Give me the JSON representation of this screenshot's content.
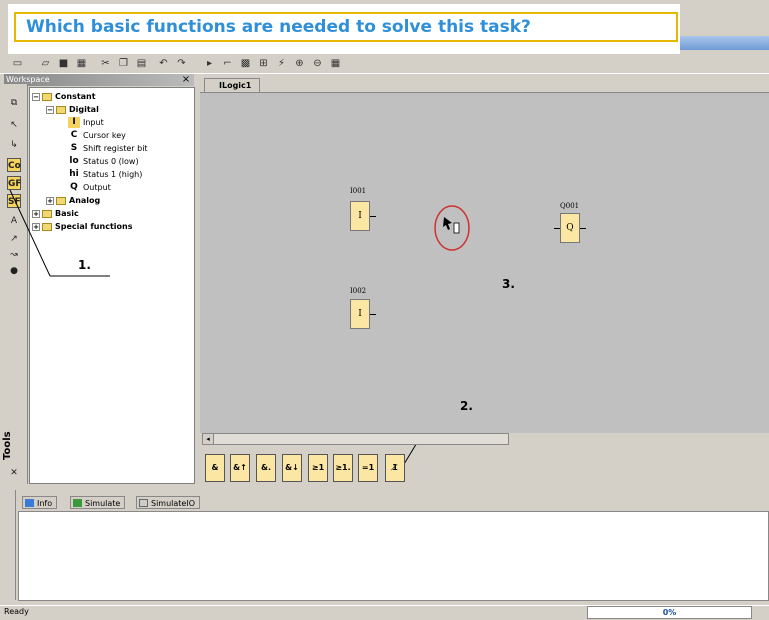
{
  "question": "Which basic functions are needed to solve this task?",
  "workspace": {
    "title": "Workspace",
    "close": "×",
    "tools_label": "Tools"
  },
  "tree": {
    "constant": "Constant",
    "digital": "Digital",
    "items": [
      {
        "icon": "I",
        "label": "Input"
      },
      {
        "icon": "C",
        "label": "Cursor key"
      },
      {
        "icon": "S",
        "label": "Shift register bit"
      },
      {
        "icon": "lo",
        "label": "Status 0 (low)"
      },
      {
        "icon": "hi",
        "label": "Status 1 (high)"
      },
      {
        "icon": "Q",
        "label": "Output"
      }
    ],
    "analog": "Analog",
    "basic": "Basic",
    "special": "Special functions"
  },
  "document_tab": "ILogic1",
  "blocks": {
    "i001_label": "I001",
    "i001_text": "I",
    "i002_label": "I002",
    "i002_text": "I",
    "q001_label": "Q001",
    "q001_text": "Q"
  },
  "annotations": {
    "one": "1.",
    "two": "2.",
    "three": "3."
  },
  "function_buttons": [
    "&",
    "&↑",
    "&.",
    "&↓",
    "≥1",
    "≥1.",
    "=1",
    "1̸"
  ],
  "bottom_tabs": {
    "info": "Info",
    "simulate": "Simulate",
    "simulate_io": "SimulateIO"
  },
  "status": {
    "text": "Ready",
    "progress": "0%"
  },
  "colors": {
    "question_text": "#2f8fd8",
    "question_border": "#e6b800",
    "canvas": "#c0c0c0",
    "block_fill": "#fce6a3"
  }
}
